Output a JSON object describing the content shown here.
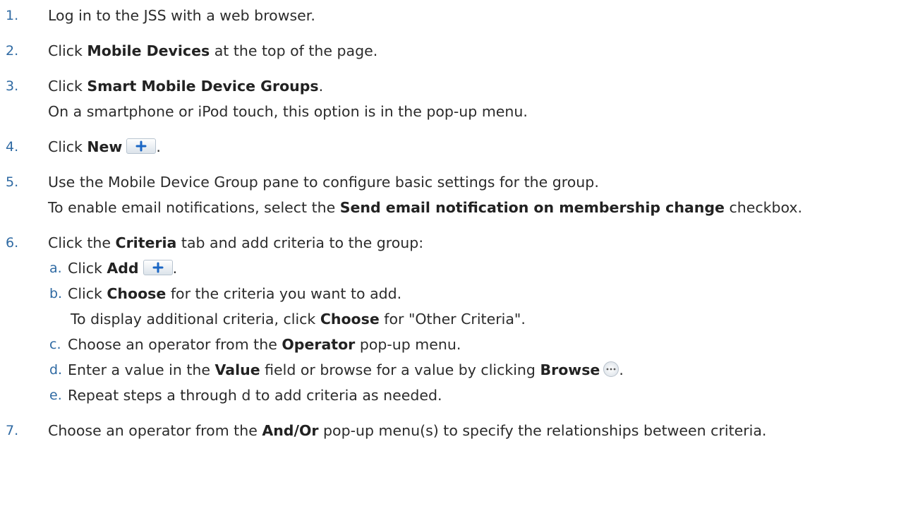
{
  "steps": [
    {
      "num": "1.",
      "text": "Log in to the JSS with a web browser."
    },
    {
      "num": "2.",
      "pre": "Click ",
      "bold": "Mobile Devices",
      "post": " at the top of the page."
    },
    {
      "num": "3.",
      "pre": "Click ",
      "bold": "Smart Mobile Device Groups",
      "post": ".",
      "note": "On a smartphone or iPod touch, this option is in the pop-up menu."
    },
    {
      "num": "4.",
      "pre": "Click ",
      "bold": "New",
      "post": "."
    },
    {
      "num": "5.",
      "text": "Use the Mobile Device Group pane to configure basic settings for the group.",
      "note_pre": "To enable email notifications, select the ",
      "note_bold": "Send email notification on membership change",
      "note_post": " checkbox."
    },
    {
      "num": "6.",
      "pre": "Click the ",
      "bold": "Criteria",
      "post": " tab and add criteria to the group:"
    },
    {
      "num": "7.",
      "pre": "Choose an operator from the ",
      "bold": "And/Or",
      "post": " pop-up menu(s) to specify the relationships between criteria."
    }
  ],
  "substeps": [
    {
      "letter": "a.",
      "pre": "Click ",
      "bold": "Add",
      "post": "."
    },
    {
      "letter": "b.",
      "pre": "Click ",
      "bold": "Choose",
      "post": " for the criteria you want to add.",
      "note_pre": "To display additional criteria, click ",
      "note_bold": "Choose",
      "note_post": " for \"Other Criteria\"."
    },
    {
      "letter": "c.",
      "pre": "Choose an operator from the ",
      "bold": "Operator",
      "post": " pop-up menu."
    },
    {
      "letter": "d.",
      "pre": "Enter a value in the ",
      "bold": "Value",
      "mid": " field or browse for a value by clicking ",
      "bold2": "Browse",
      "post": "."
    },
    {
      "letter": "e.",
      "text": "Repeat steps a through d to add criteria as needed."
    }
  ],
  "icons": {
    "add": "plus-icon",
    "browse": "ellipsis-icon"
  },
  "colors": {
    "step_number": "#2f6aa3",
    "icon_plus": "#1a66c4"
  }
}
